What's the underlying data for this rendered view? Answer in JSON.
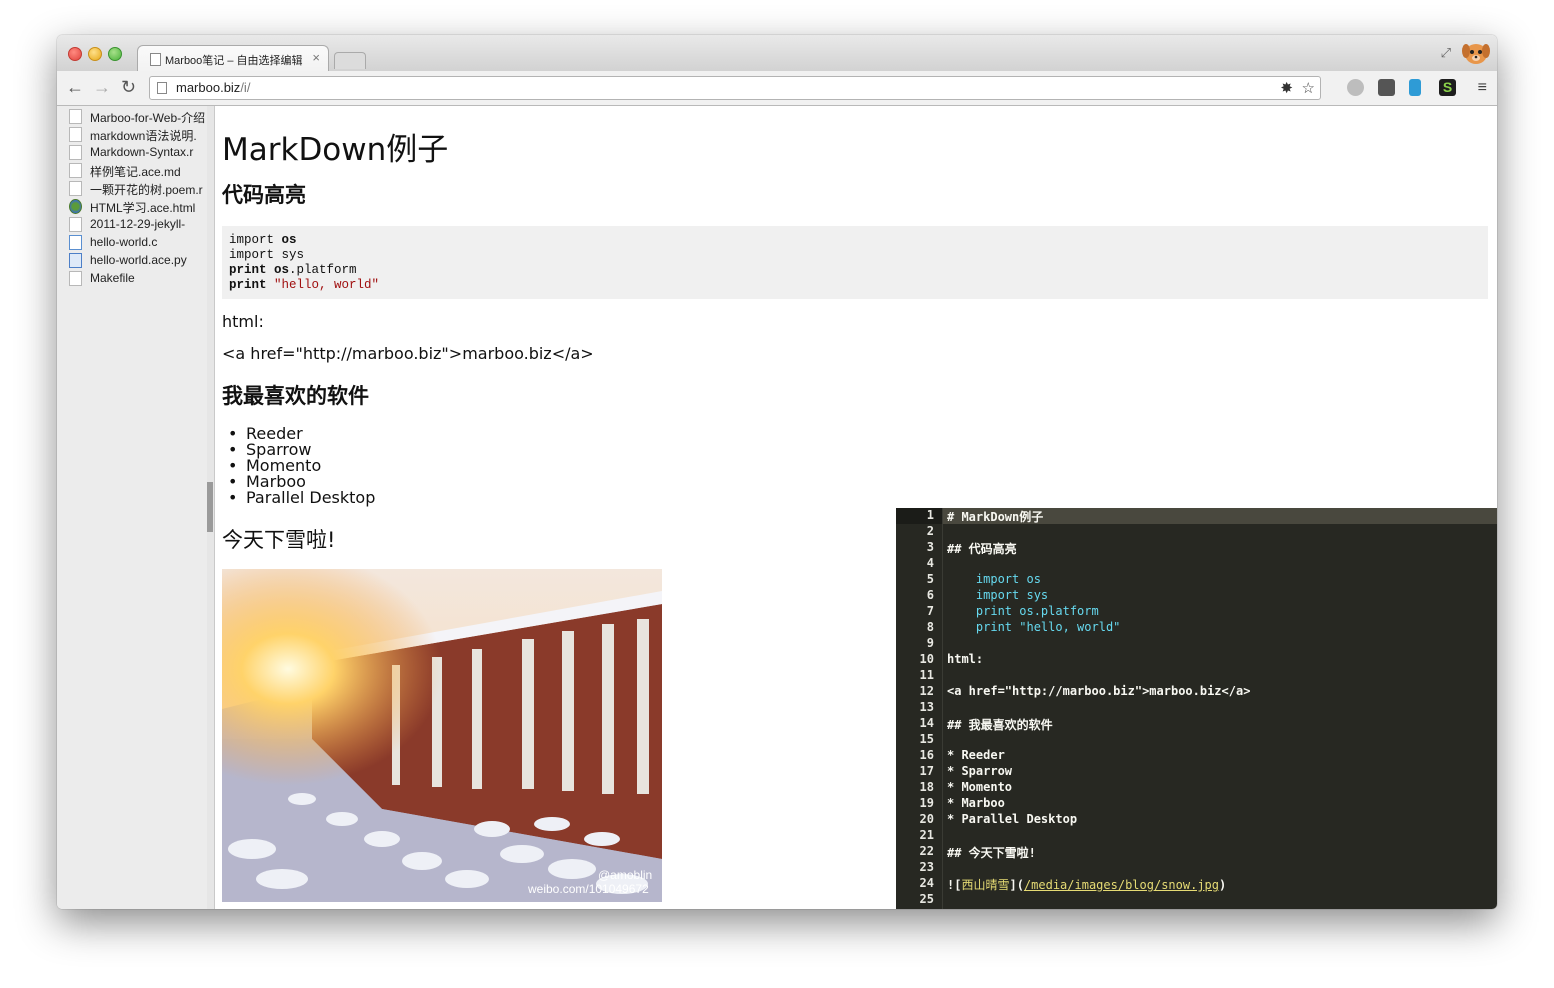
{
  "browser": {
    "tab_title": "Marboo笔记 – 自由选择编辑",
    "tab_close": "×",
    "url_host": "marboo.biz",
    "url_path": "/i/",
    "nav": {
      "back": "←",
      "forward": "→",
      "reload": "↻"
    },
    "menu": "≡",
    "fullscreen": "⤢",
    "star": "☆",
    "ext_colors": [
      "#9e9e9e",
      "#555555",
      "#2e9bd6",
      "#1d1d1d"
    ]
  },
  "sidebar": {
    "files": [
      {
        "name": "Marboo-for-Web-介绍",
        "kind": "doc"
      },
      {
        "name": "markdown语法说明.",
        "kind": "doc"
      },
      {
        "name": "Markdown-Syntax.r",
        "kind": "doc"
      },
      {
        "name": "样例笔记.ace.md",
        "kind": "doc"
      },
      {
        "name": "一颗开花的树.poem.r",
        "kind": "doc"
      },
      {
        "name": "HTML学习.ace.html",
        "kind": "html"
      },
      {
        "name": "2011-12-29-jekyll-",
        "kind": "doc"
      },
      {
        "name": "hello-world.c",
        "kind": "c"
      },
      {
        "name": "hello-world.ace.py",
        "kind": "py"
      },
      {
        "name": "Makefile",
        "kind": "doc"
      }
    ]
  },
  "preview": {
    "h1": "MarkDown例子",
    "h2_code": "代码高亮",
    "code": {
      "l1_kw": "import",
      "l1_mod": "os",
      "l2_kw": "import",
      "l2_mod": "sys",
      "l3_kw": "print",
      "l3_mod": "os",
      "l3_rest": ".platform",
      "l4_kw": "print",
      "l4_str": "\"hello, world\""
    },
    "html_label": "html:",
    "html_example": "<a href=\"http://marboo.biz\">marboo.biz</a>",
    "h2_software": "我最喜欢的软件",
    "software": [
      "Reeder",
      "Sparrow",
      "Momento",
      "Marboo",
      "Parallel Desktop"
    ],
    "h2_snow": "今天下雪啦!",
    "image_watermark_handle": "@amoblin",
    "image_watermark_url": "weibo.com/101049672"
  },
  "editor": {
    "line_numbers": [
      "1",
      "2",
      "3",
      "4",
      "5",
      "6",
      "7",
      "8",
      "9",
      "10",
      "11",
      "12",
      "13",
      "14",
      "15",
      "16",
      "17",
      "18",
      "19",
      "20",
      "21",
      "22",
      "23",
      "24",
      "25"
    ],
    "lines": {
      "l1": "# MarkDown例子",
      "l3": "## 代码高亮",
      "l5": "    import os",
      "l6": "    import sys",
      "l7": "    print os.platform",
      "l8": "    print \"hello, world\"",
      "l10": "html:",
      "l12": "<a href=\"http://marboo.biz\">marboo.biz</a>",
      "l14": "## 我最喜欢的软件",
      "l16": "* Reeder",
      "l17": "* Sparrow",
      "l18": "* Momento",
      "l19": "* Marboo",
      "l20": "* Parallel Desktop",
      "l22": "## 今天下雪啦!",
      "l24_a": "![",
      "l24_alt": "西山晴雪",
      "l24_b": "](",
      "l24_link": "/media/images/blog/snow.jpg",
      "l24_c": ")"
    }
  }
}
